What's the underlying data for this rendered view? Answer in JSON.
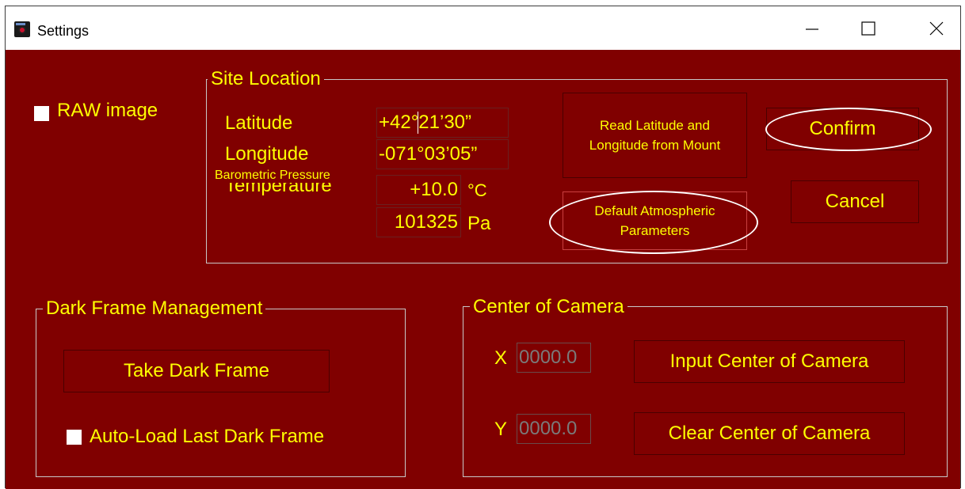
{
  "window": {
    "title": "Settings",
    "icons": {
      "app": "camera-app-icon",
      "minimize": "minimize-icon",
      "maximize": "maximize-icon",
      "close": "close-icon"
    }
  },
  "raw_image": {
    "label": "RAW image",
    "checked": false
  },
  "site_location": {
    "legend": "Site Location",
    "latitude_label": "Latitude",
    "longitude_label": "Longitude",
    "pressure_label": "Barometric Pressure",
    "temperature_label": "Temperature",
    "latitude_value": "+42°21’30”",
    "longitude_value": "-071°03’05”",
    "temperature_value": "+10.0",
    "temperature_unit": "°C",
    "pressure_value": "101325",
    "pressure_unit": "Pa",
    "read_button_line1": "Read Latitude and",
    "read_button_line2": "Longitude from Mount",
    "default_button_line1": "Default Atmospheric",
    "default_button_line2": "Parameters"
  },
  "actions": {
    "confirm": "Confirm",
    "cancel": "Cancel"
  },
  "dark_frame": {
    "legend": "Dark Frame Management",
    "take_button": "Take Dark Frame",
    "auto_load_label": "Auto-Load Last Dark Frame",
    "auto_load_checked": false
  },
  "center_camera": {
    "legend": "Center of Camera",
    "x_label": "X",
    "y_label": "Y",
    "x_value": "0000.0",
    "y_value": "0000.0",
    "input_button": "Input Center of Camera",
    "clear_button": "Clear Center of Camera"
  },
  "colors": {
    "background": "#800000",
    "text": "#ffff00",
    "annotation": "#ffffff",
    "disabled_text": "#7a7a7a"
  }
}
